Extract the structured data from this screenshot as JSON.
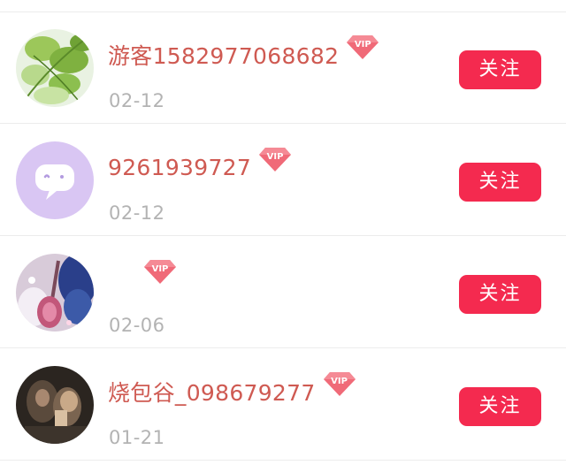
{
  "vip_label": "VIP",
  "colors": {
    "name": "#cf5a52",
    "date": "#b3b3b3",
    "follow_button": "#f42a4f",
    "vip_badge": "#f06a78"
  },
  "users": [
    {
      "name": "游客1582977068682",
      "date": "02-12",
      "vip": true,
      "follow_label": "关注",
      "avatar": "green-leaves-photo"
    },
    {
      "name": "9261939727",
      "date": "02-12",
      "vip": true,
      "follow_label": "关注",
      "avatar": "purple-chat-icon"
    },
    {
      "name": "",
      "date": "02-06",
      "vip": true,
      "follow_label": "关注",
      "avatar": "pipa-instrument-photo"
    },
    {
      "name": "烧包谷_098679277",
      "date": "01-21",
      "vip": true,
      "follow_label": "关注",
      "avatar": "dark-portrait-photo"
    }
  ]
}
